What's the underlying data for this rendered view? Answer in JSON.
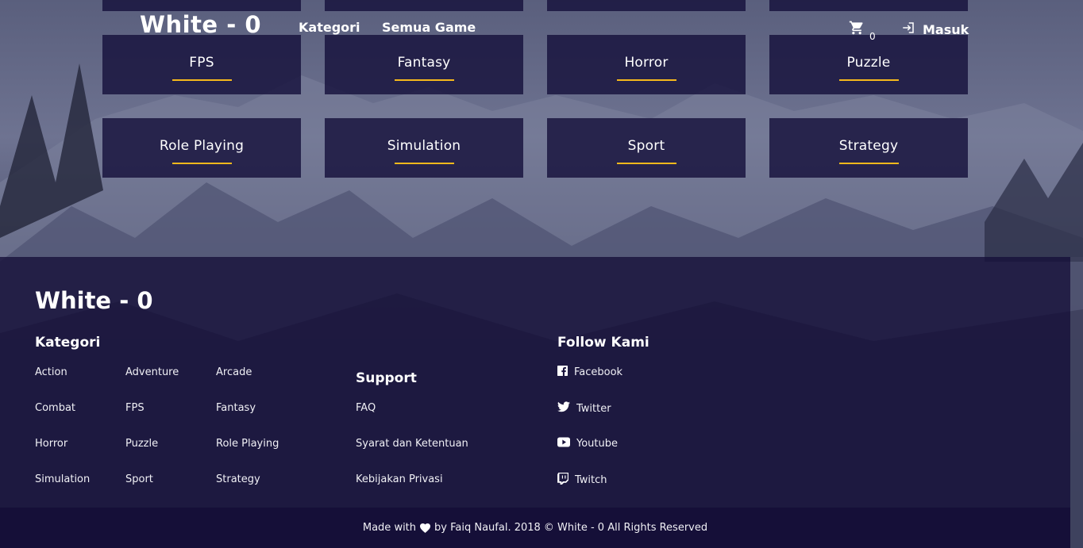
{
  "colors": {
    "accent": "#f6b91c",
    "card_bg": "#16113c",
    "footer_bg": "#16103a",
    "text": "#ffffff"
  },
  "navbar": {
    "brand": "White - 0",
    "links": [
      "Kategori",
      "Semua Game"
    ],
    "cart_icon": "cart-icon",
    "cart_count": "0",
    "login_icon": "login-icon",
    "login_label": "Masuk"
  },
  "categories": [
    "FPS",
    "Fantasy",
    "Horror",
    "Puzzle",
    "Role Playing",
    "Simulation",
    "Sport",
    "Strategy"
  ],
  "footer": {
    "brand": "White - 0",
    "kategori": {
      "title": "Kategori",
      "items": [
        "Action",
        "Adventure",
        "Arcade",
        "Combat",
        "FPS",
        "Fantasy",
        "Horror",
        "Puzzle",
        "Role Playing",
        "Simulation",
        "Sport",
        "Strategy"
      ]
    },
    "support": {
      "title": "Support",
      "items": [
        "FAQ",
        "Syarat dan Ketentuan",
        "Kebijakan Privasi"
      ]
    },
    "follow": {
      "title": "Follow Kami",
      "items": [
        {
          "label": "Facebook",
          "icon": "facebook-icon"
        },
        {
          "label": "Twitter",
          "icon": "twitter-icon"
        },
        {
          "label": "Youtube",
          "icon": "youtube-icon"
        },
        {
          "label": "Twitch",
          "icon": "twitch-icon"
        }
      ]
    },
    "copyright_pre": "Made with",
    "copyright_post": "by Faiq Naufal. 2018 © White - 0 All Rights Reserved"
  }
}
